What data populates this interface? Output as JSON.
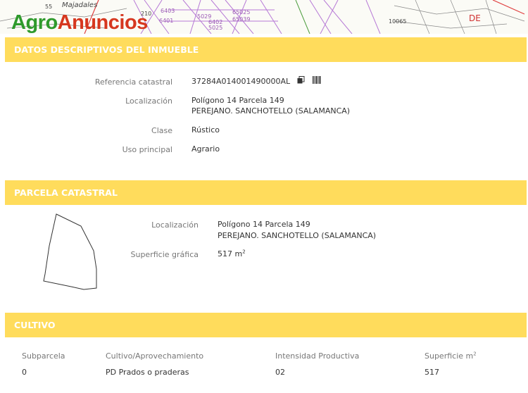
{
  "banner": {
    "logo_part1": "Agro",
    "logo_part2": "Anuncios",
    "map_labels": [
      "55",
      "Majadales",
      "210",
      "6403",
      "6401",
      "5029",
      "6402",
      "5025",
      "65025",
      "65039",
      "10065",
      "DE"
    ]
  },
  "section1": {
    "title": "DATOS DESCRIPTIVOS DEL INMUEBLE",
    "fields": {
      "ref_label": "Referencia catastral",
      "ref_value": "37284A014001490000AL",
      "loc_label": "Localización",
      "loc_line1": "Polígono 14 Parcela 149",
      "loc_line2": "PEREJANO. SANCHOTELLO (SALAMANCA)",
      "clase_label": "Clase",
      "clase_value": "Rústico",
      "uso_label": "Uso principal",
      "uso_value": "Agrario"
    }
  },
  "section2": {
    "title": "PARCELA CATASTRAL",
    "fields": {
      "loc_label": "Localización",
      "loc_line1": "Polígono 14 Parcela 149",
      "loc_line2": "PEREJANO. SANCHOTELLO (SALAMANCA)",
      "sup_label": "Superficie gráfica",
      "sup_value": "517 m",
      "sup_unit_exp": "2"
    }
  },
  "section3": {
    "title": "CULTIVO",
    "headers": {
      "subparcela": "Subparcela",
      "cultivo": "Cultivo/Aprovechamiento",
      "intensidad": "Intensidad Productiva",
      "superficie": "Superficie m",
      "superficie_exp": "2"
    },
    "row": {
      "subparcela": "0",
      "cultivo": "PD Prados o praderas",
      "intensidad": "02",
      "superficie": "517"
    }
  },
  "colors": {
    "section_header": "#ffdc5c",
    "logo_green": "#2f9a2c",
    "logo_red": "#d6371f"
  }
}
